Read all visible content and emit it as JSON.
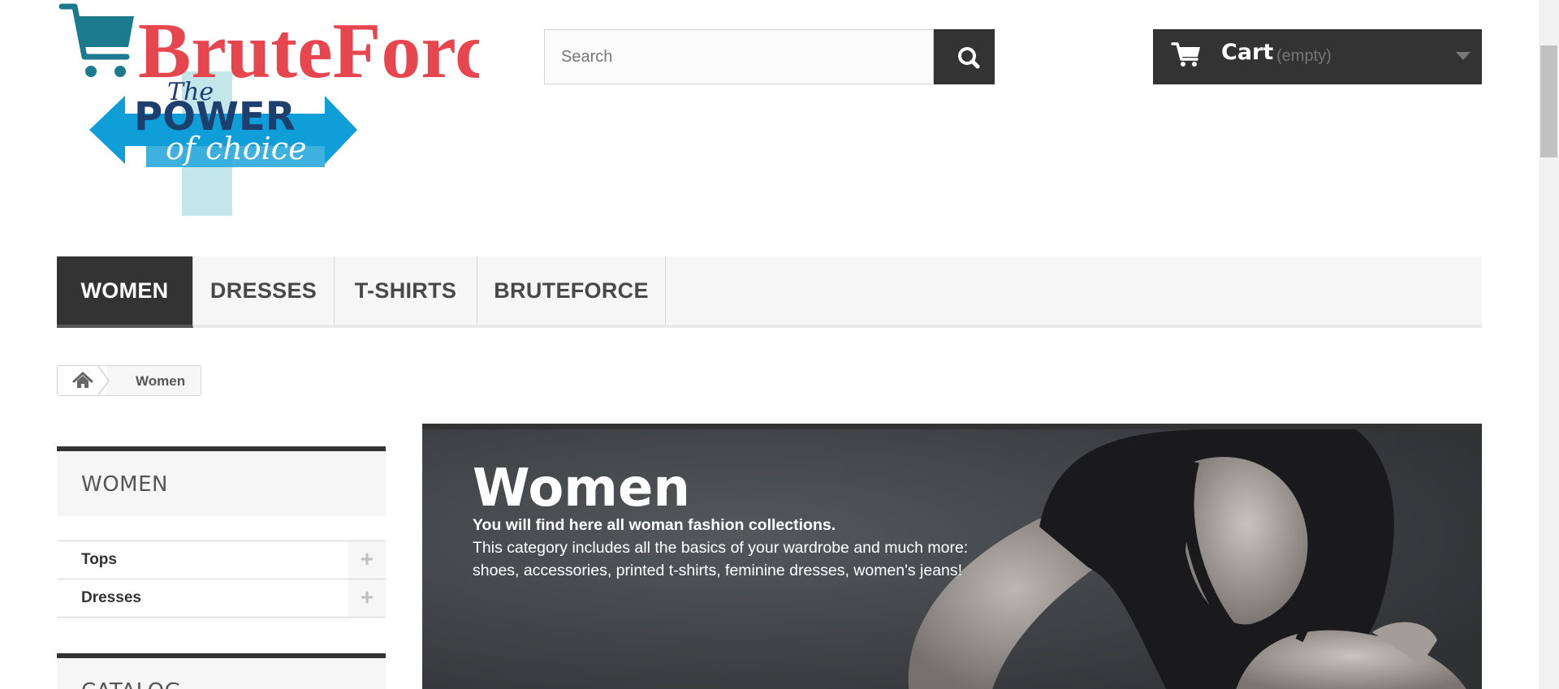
{
  "header": {
    "logo": {
      "brand": "BruteForce",
      "tagline_line1": "The",
      "tagline_line2": "POWER",
      "tagline_line3": "of choice"
    },
    "search": {
      "placeholder": "Search",
      "value": "",
      "icon": "search-icon"
    },
    "cart": {
      "label": "Cart",
      "status": "(empty)",
      "icon": "shopping-cart-icon"
    }
  },
  "menu": {
    "items": [
      {
        "label": "WOMEN",
        "active": true
      },
      {
        "label": "DRESSES",
        "active": false
      },
      {
        "label": "T-SHIRTS",
        "active": false
      },
      {
        "label": "BRUTEFORCE",
        "active": false
      }
    ]
  },
  "breadcrumb": {
    "home_icon": "home-icon",
    "current": "Women"
  },
  "sidebar": {
    "block_title": "WOMEN",
    "categories": [
      {
        "label": "Tops",
        "toggle": "+"
      },
      {
        "label": "Dresses",
        "toggle": "+"
      }
    ],
    "second_block_title": "CATALOG"
  },
  "banner": {
    "title": "Women",
    "bold_line": "You will find here all woman fashion collections.",
    "line1": "This category includes all the basics of your wardrobe and much more:",
    "line2": "shoes, accessories, printed t-shirts, feminine dresses, women's jeans!"
  },
  "colors": {
    "dark": "#333333",
    "logo_red": "#e8464e",
    "logo_blue": "#0f9ed8",
    "logo_navy": "#1c3f6e"
  }
}
